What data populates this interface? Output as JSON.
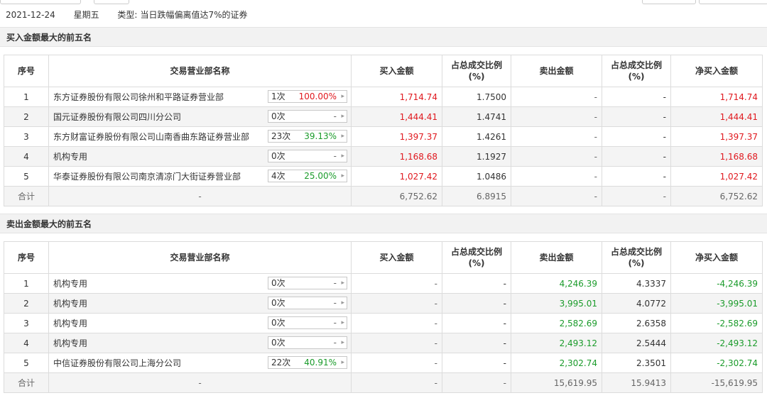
{
  "info": {
    "date": "2021-12-24",
    "weekday": "星期五",
    "type_label": "类型:",
    "type_value": "当日跌幅偏离值达7%的证券"
  },
  "columns": [
    "序号",
    "交易营业部名称",
    "买入金额",
    "占总成交比例(%)",
    "卖出金额",
    "占总成交比例(%)",
    "净买入金额"
  ],
  "buy_section": {
    "title": "买入金额最大的前五名",
    "rows": [
      {
        "idx": "1",
        "name": "东方证券股份有限公司徐州和平路证券营业部",
        "count": "1次",
        "pct": "100.00%",
        "pct_color": "red",
        "buy": "1,714.74",
        "buy_ratio": "1.7500",
        "sell": "-",
        "sell_ratio": "-",
        "net": "1,714.74"
      },
      {
        "idx": "2",
        "name": "国元证券股份有限公司四川分公司",
        "count": "0次",
        "pct": "-",
        "pct_color": "gray",
        "buy": "1,444.41",
        "buy_ratio": "1.4741",
        "sell": "-",
        "sell_ratio": "-",
        "net": "1,444.41"
      },
      {
        "idx": "3",
        "name": "东方财富证券股份有限公司山南香曲东路证券营业部",
        "count": "23次",
        "pct": "39.13%",
        "pct_color": "green",
        "buy": "1,397.37",
        "buy_ratio": "1.4261",
        "sell": "-",
        "sell_ratio": "-",
        "net": "1,397.37"
      },
      {
        "idx": "4",
        "name": "机构专用",
        "count": "0次",
        "pct": "-",
        "pct_color": "gray",
        "buy": "1,168.68",
        "buy_ratio": "1.1927",
        "sell": "-",
        "sell_ratio": "-",
        "net": "1,168.68"
      },
      {
        "idx": "5",
        "name": "华泰证券股份有限公司南京清凉门大街证券营业部",
        "count": "4次",
        "pct": "25.00%",
        "pct_color": "green",
        "buy": "1,027.42",
        "buy_ratio": "1.0486",
        "sell": "-",
        "sell_ratio": "-",
        "net": "1,027.42"
      }
    ],
    "total": {
      "label": "合计",
      "name": "-",
      "buy": "6,752.62",
      "buy_ratio": "6.8915",
      "sell": "-",
      "sell_ratio": "-",
      "net": "6,752.62"
    }
  },
  "sell_section": {
    "title": "卖出金额最大的前五名",
    "rows": [
      {
        "idx": "1",
        "name": "机构专用",
        "count": "0次",
        "pct": "-",
        "pct_color": "gray",
        "buy": "-",
        "buy_ratio": "-",
        "sell": "4,246.39",
        "sell_ratio": "4.3337",
        "net": "-4,246.39"
      },
      {
        "idx": "2",
        "name": "机构专用",
        "count": "0次",
        "pct": "-",
        "pct_color": "gray",
        "buy": "-",
        "buy_ratio": "-",
        "sell": "3,995.01",
        "sell_ratio": "4.0772",
        "net": "-3,995.01"
      },
      {
        "idx": "3",
        "name": "机构专用",
        "count": "0次",
        "pct": "-",
        "pct_color": "gray",
        "buy": "-",
        "buy_ratio": "-",
        "sell": "2,582.69",
        "sell_ratio": "2.6358",
        "net": "-2,582.69"
      },
      {
        "idx": "4",
        "name": "机构专用",
        "count": "0次",
        "pct": "-",
        "pct_color": "gray",
        "buy": "-",
        "buy_ratio": "-",
        "sell": "2,493.12",
        "sell_ratio": "2.5444",
        "net": "-2,493.12"
      },
      {
        "idx": "5",
        "name": "中信证券股份有限公司上海分公司",
        "count": "22次",
        "pct": "40.91%",
        "pct_color": "green",
        "buy": "-",
        "buy_ratio": "-",
        "sell": "2,302.74",
        "sell_ratio": "2.3501",
        "net": "-2,302.74"
      }
    ],
    "total": {
      "label": "合计",
      "name": "-",
      "buy": "-",
      "buy_ratio": "-",
      "sell": "15,619.95",
      "sell_ratio": "15.9413",
      "net": "-15,619.95"
    }
  },
  "colors": {
    "up": "#e0181e",
    "down": "#1a9b2a",
    "neutral": "#666666",
    "header_bg": "#f2f2f2"
  }
}
